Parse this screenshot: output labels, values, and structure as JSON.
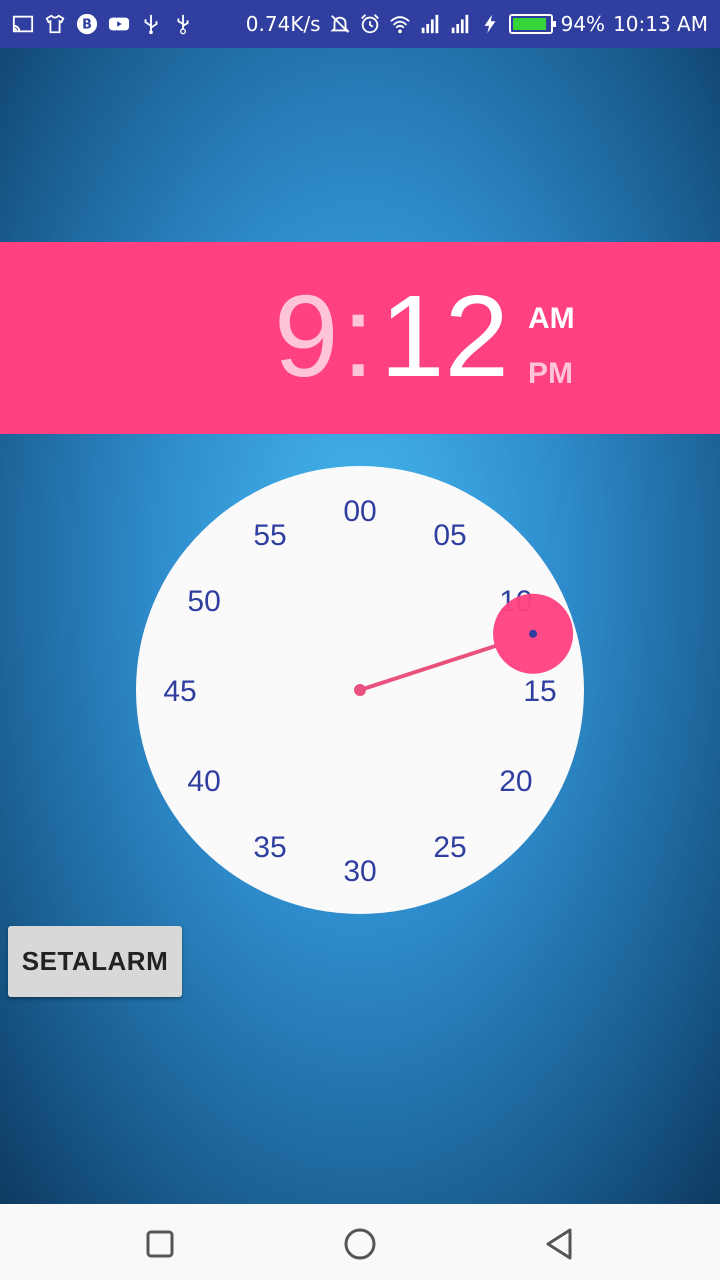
{
  "status_bar": {
    "left_icons": [
      "cast-icon",
      "tshirt-icon",
      "b-circle-icon",
      "youtube-icon",
      "usb-icon",
      "usb-debug-icon"
    ],
    "net_speed": "0.74K/s",
    "right_icons": [
      "notifications-off-icon",
      "alarm-icon",
      "wifi-icon",
      "signal-icon",
      "signal-icon-2",
      "charging-icon"
    ],
    "battery_level": 0.94,
    "battery_text": "94%",
    "time": "10:13 AM"
  },
  "time_picker": {
    "hour": "9",
    "separator": ":",
    "minute": "12",
    "am_label": "AM",
    "pm_label": "PM",
    "selected_period": "AM",
    "colors": {
      "header_bg": "#ff4081",
      "accent": "#ff4081",
      "number_color": "#303f9f",
      "face": "#fafafa"
    },
    "dial": {
      "labels": [
        "00",
        "05",
        "10",
        "15",
        "20",
        "25",
        "30",
        "35",
        "40",
        "45",
        "50",
        "55"
      ],
      "selected_minute": 12
    }
  },
  "set_alarm_button": "SETALARM",
  "nav_bar": {
    "icons": [
      "recent-apps-icon",
      "home-icon",
      "back-icon"
    ]
  }
}
